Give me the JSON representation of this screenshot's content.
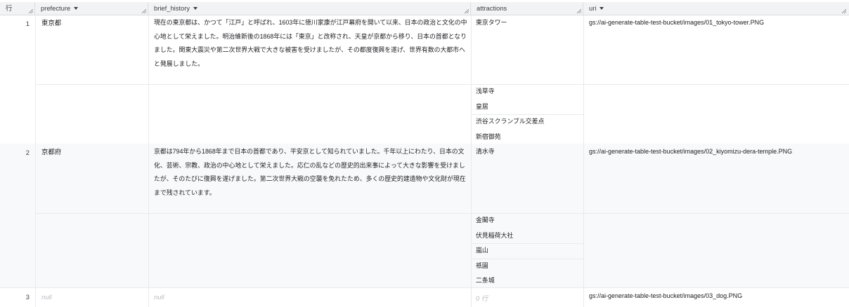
{
  "header": {
    "row_label": "行",
    "columns": [
      {
        "label": "prefecture"
      },
      {
        "label": "brief_history"
      },
      {
        "label": "attractions"
      },
      {
        "label": "uri"
      }
    ]
  },
  "rows": [
    {
      "num": "1",
      "prefecture": "東京都",
      "history": "現在の東京都は、かつて「江戸」と呼ばれ、1603年に徳川家康が江戸幕府を開いて以来、日本の政治と文化の中心地として栄えました。明治維新後の1868年には「東京」と改称され、天皇が京都から移り、日本の首都となりました。関東大震災や第二次世界大戦で大きな被害を受けましたが、その都度復興を遂げ、世界有数の大都市へと発展しました。",
      "attractions": [
        "東京タワー",
        "浅草寺",
        "皇居",
        "渋谷スクランブル交差点",
        "新宿御苑"
      ],
      "uri": "gs://ai-generate-table-test-bucket/images/01_tokyo-tower.PNG"
    },
    {
      "num": "2",
      "prefecture": "京都府",
      "history": "京都は794年から1868年まで日本の首都であり、平安京として知られていました。千年以上にわたり、日本の文化、芸術、宗教、政治の中心地として栄えました。応仁の乱などの歴史的出来事によって大きな影響を受けましたが、そのたびに復興を遂げました。第二次世界大戦の空襲を免れたため、多くの歴史的建造物や文化財が現在まで残されています。",
      "attractions": [
        "清水寺",
        "金閣寺",
        "伏見稲荷大社",
        "嵐山",
        "祇園",
        "二条城"
      ],
      "uri": "gs://ai-generate-table-test-bucket/images/02_kiyomizu-dera-temple.PNG"
    },
    {
      "num": "3",
      "prefecture": "null",
      "history": "null",
      "attractions_empty": "0 行",
      "uri": "gs://ai-generate-table-test-bucket/images/03_dog.PNG"
    }
  ]
}
